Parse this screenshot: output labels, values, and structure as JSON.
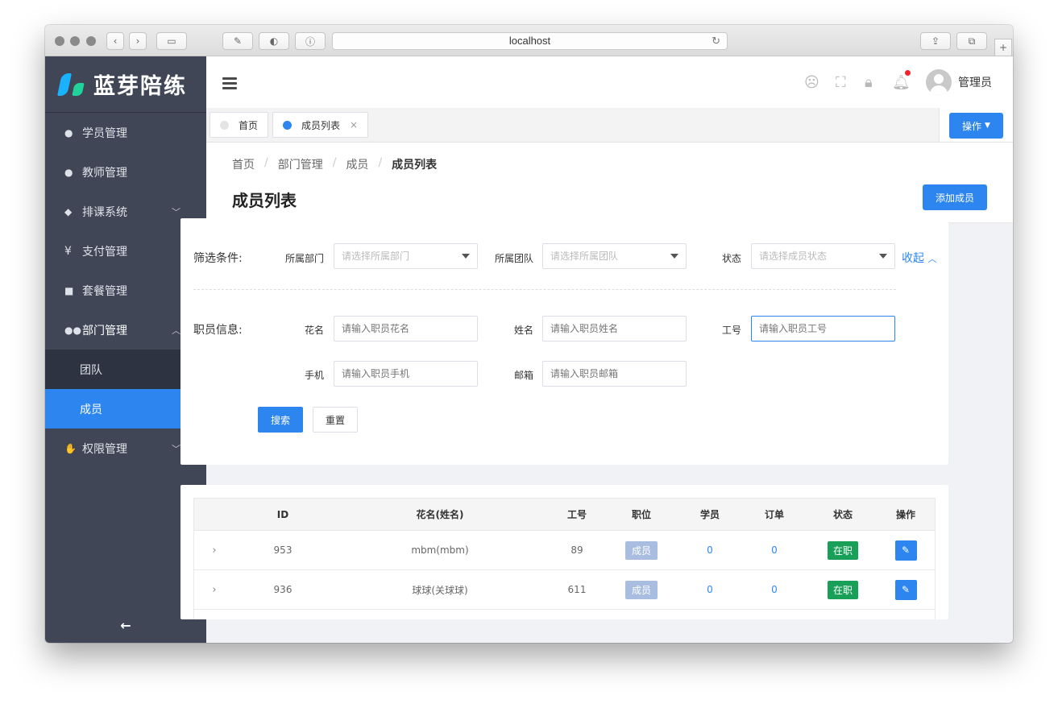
{
  "browser": {
    "url": "localhost"
  },
  "sidebar": {
    "logo_text": "蓝芽陪练",
    "items": [
      {
        "label": "学员管理",
        "icon": "student-icon"
      },
      {
        "label": "教师管理",
        "icon": "teacher-icon"
      },
      {
        "label": "排课系统",
        "icon": "graduation-cap-icon"
      },
      {
        "label": "支付管理",
        "icon": "yen-icon"
      },
      {
        "label": "套餐管理",
        "icon": "package-icon"
      },
      {
        "label": "部门管理",
        "icon": "group-icon"
      },
      {
        "label": "权限管理",
        "icon": "hand-icon"
      }
    ],
    "sub_items": [
      {
        "label": "团队"
      },
      {
        "label": "成员"
      }
    ],
    "collapse_icon": "arrow-left-icon"
  },
  "header": {
    "user_name": "管理员",
    "icons": [
      "sad-face-icon",
      "fullscreen-icon",
      "lock-icon",
      "bell-icon"
    ],
    "notification_dot": true
  },
  "tabs": [
    {
      "label": "首页",
      "active": false
    },
    {
      "label": "成员列表",
      "active": true,
      "close": "×"
    }
  ],
  "ops_button": "操作",
  "breadcrumb": [
    "首页",
    "部门管理",
    "成员",
    "成员列表"
  ],
  "breadcrumb_sep": "/",
  "page_title": "成员列表",
  "add_button": "添加成员",
  "filter": {
    "title": "筛选条件:",
    "dept_label": "所属部门",
    "dept_placeholder": "请选择所属部门",
    "team_label": "所属团队",
    "team_placeholder": "请选择所属团队",
    "status_label": "状态",
    "status_placeholder": "请选择成员状态",
    "collapse_label": "收起",
    "info_title": "职员信息:",
    "nickname_label": "花名",
    "nickname_placeholder": "请输入职员花名",
    "name_label": "姓名",
    "name_placeholder": "请输入职员姓名",
    "jobno_label": "工号",
    "jobno_placeholder": "请输入职员工号",
    "phone_label": "手机",
    "phone_placeholder": "请输入职员手机",
    "email_label": "邮箱",
    "email_placeholder": "请输入职员邮箱",
    "search_button": "搜索",
    "reset_button": "重置"
  },
  "table": {
    "columns": [
      "ID",
      "花名(姓名)",
      "工号",
      "职位",
      "学员",
      "订单",
      "状态",
      "操作"
    ],
    "rows": [
      {
        "id": "953",
        "name": "mbm(mbm)",
        "jobno": "89",
        "role": "成员",
        "students": "0",
        "orders": "0",
        "status": "在职"
      },
      {
        "id": "936",
        "name": "球球(关球球)",
        "jobno": "611",
        "role": "成员",
        "students": "0",
        "orders": "0",
        "status": "在职"
      }
    ]
  },
  "colors": {
    "primary": "#2d86f0",
    "sidebar_bg": "#404656",
    "submenu_bg": "#2e3341",
    "status_green": "#18a058",
    "role_tag": "#a9bde0",
    "notification": "#f5222d"
  }
}
